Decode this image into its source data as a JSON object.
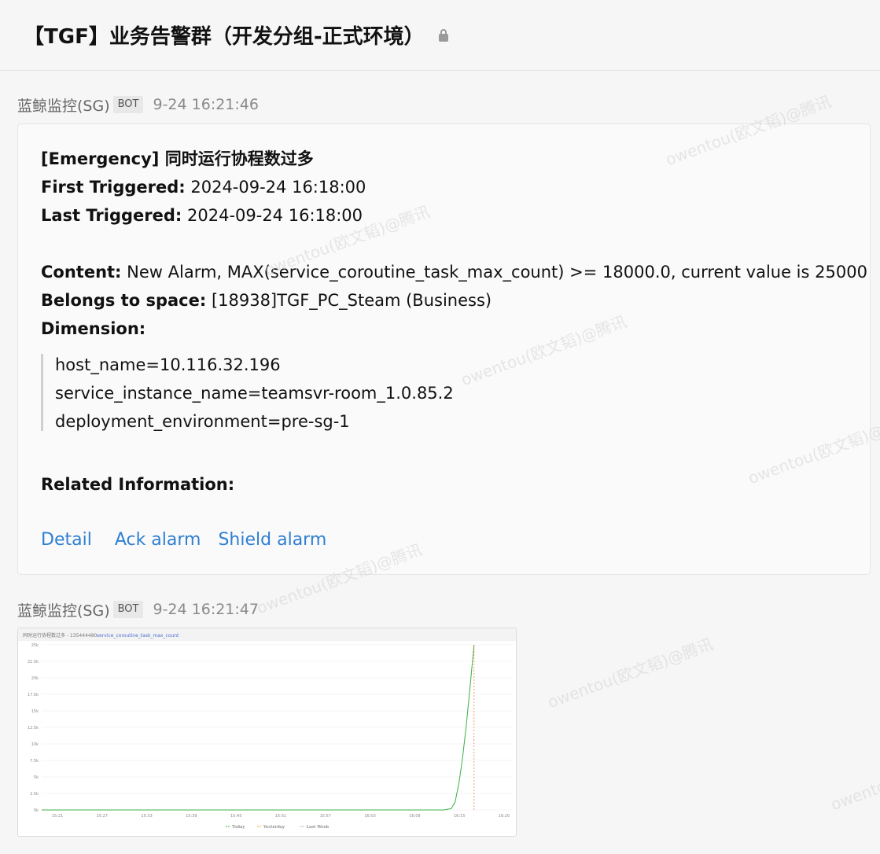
{
  "header": {
    "title": "【TGF】业务告警群（开发分组-正式环境）"
  },
  "messages": [
    {
      "sender": "蓝鲸监控(SG)",
      "badge": "BOT",
      "time": "9-24 16:21:46",
      "alarm": {
        "title": "[Emergency] 同时运行协程数过多",
        "first_triggered_label": "First Triggered:",
        "first_triggered": "2024-09-24 16:18:00",
        "last_triggered_label": "Last Triggered:",
        "last_triggered": "2024-09-24 16:18:00",
        "content_label": "Content:",
        "content": "New Alarm, MAX(service_coroutine_task_max_count) >= 18000.0, current value is 25000",
        "space_label": "Belongs to space:",
        "space": "[18938]TGF_PC_Steam (Business)",
        "dimension_label": "Dimension:",
        "dimensions": [
          "host_name=10.116.32.196",
          "service_instance_name=teamsvr-room_1.0.85.2",
          "deployment_environment=pre-sg-1"
        ],
        "related_label": "Related Information:",
        "links": [
          "Detail",
          "Ack alarm",
          "Shield alarm"
        ]
      }
    },
    {
      "sender": "蓝鲸监控(SG)",
      "badge": "BOT",
      "time": "9-24 16:21:47"
    }
  ],
  "chart_data": {
    "type": "line",
    "title": "同时运行协程数过多 - 135444480",
    "subtitle": "service_coroutine_task_max_count",
    "yticks": [
      "0k",
      "2.5k",
      "5k",
      "7.5k",
      "10k",
      "12.5k",
      "15k",
      "17.5k",
      "20k",
      "22.5k",
      "25k"
    ],
    "xticks": [
      "15:21",
      "15:27",
      "15:33",
      "15:39",
      "15:45",
      "15:51",
      "15:57",
      "16:03",
      "16:09",
      "16:15",
      "16:20"
    ],
    "ylim": [
      0,
      25000
    ],
    "series": [
      {
        "name": "Today",
        "color": "#3cb043",
        "x": [
          "15:21",
          "15:30",
          "15:40",
          "15:50",
          "16:00",
          "16:10",
          "16:14",
          "16:15",
          "16:15.5",
          "16:16",
          "16:16.5",
          "16:17",
          "16:17.5",
          "16:18"
        ],
        "values": [
          0,
          0,
          0,
          0,
          0,
          0,
          0,
          200,
          1200,
          4000,
          8000,
          13000,
          19000,
          25000
        ]
      },
      {
        "name": "Yesterday",
        "color": "#f0a830"
      },
      {
        "name": "Last Week",
        "color": "#b0b0b0"
      }
    ],
    "marker_x": "16:18",
    "marker_color": "#f08040"
  },
  "watermark": "owentou(欧文韬)@腾讯"
}
